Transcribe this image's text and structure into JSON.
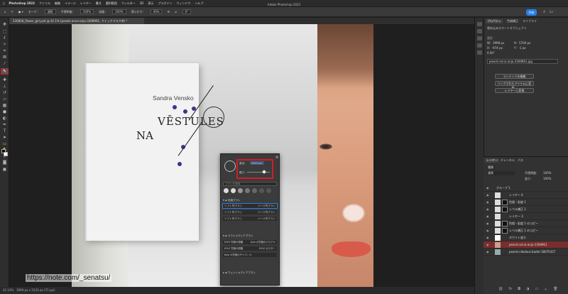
{
  "menubar": {
    "app": "Photoshop 2023",
    "items": [
      "ファイル",
      "編集",
      "イメージ",
      "レイヤー",
      "書式",
      "選択範囲",
      "フィルター",
      "3D",
      "表示",
      "プラグイン",
      "ウィンドウ",
      "ヘルプ"
    ]
  },
  "window_title": "Adobe Photoshop 2023",
  "options": {
    "mode_label": "モード：",
    "mode_value": "通常",
    "opacity_label": "不透明度：",
    "opacity_value": "100%",
    "flow_label": "流量：",
    "flow_value": "100%",
    "smooth_label": "滑らかさ：",
    "smooth_value": "40%",
    "angle_value": "0°",
    "share_label": "共有"
  },
  "document_tab": "230828_flower_girl.psd @ 42.1% (pexels-anna-anja-3308961, クイックマスク/8) *",
  "canvas": {
    "author": "Sandra Vensko",
    "title_line1": "VĒSTULES",
    "title_line2": "NA"
  },
  "brush_popup": {
    "size_label": "直径：",
    "size_value": "1012 px",
    "hardness_label": "硬さ：",
    "search_placeholder": "ブラシを検索",
    "group1": "汎用ブラシ",
    "brushes": [
      {
        "left": "ソフト円ブラシ",
        "right": "ハード円ブラシ"
      },
      {
        "left": "ソフト円ブラシ",
        "right": "ハード円ブラシ"
      },
      {
        "left": "ソフト円ブラシ",
        "right": "ハード円ブラシ"
      }
    ],
    "group2": "ドライメディアブラシ",
    "dry": [
      {
        "left": "KYLE 究極の鉛筆",
        "right": "Kyle の究極のパステル"
      },
      {
        "left": "KYLE 究極の鉛筆",
        "right": "KYLE ポスター"
      },
      {
        "left": "Kyle の究極のチャコール",
        "right": ""
      }
    ],
    "group3": "ウェットメディアブラシ"
  },
  "properties": {
    "tab1": "プロパティ",
    "tab2": "色調補正",
    "tab3": "ライブラリ",
    "section": "埋め込みスマートオブジェクト",
    "transform": "変形",
    "w": "W：3998 px",
    "h": "H：5700 px",
    "x": "X：-974 px",
    "y": "Y：-1 px",
    "angle": "0.00°",
    "file": "pexels-anna-anja-3308961.jpg",
    "btn1": "コンテンツを編集",
    "btn2": "リンクされたアイテムに変換...",
    "btn3": "レイヤーに変換"
  },
  "layers": {
    "tab1": "レイヤー",
    "tab2": "チャンネル",
    "tab3": "パス",
    "kind": "種類",
    "blend": "通常",
    "opacity_label": "不透明度：",
    "opacity_value": "100%",
    "fill_label": "塗り：",
    "fill_value": "100%",
    "items": [
      {
        "name": "グループ 1",
        "selected": false
      },
      {
        "name": "レイヤー 4",
        "selected": false
      },
      {
        "name": "色相・彩度 1",
        "selected": false
      },
      {
        "name": "レベル補正 1",
        "selected": false
      },
      {
        "name": "レイヤー 3",
        "selected": false
      },
      {
        "name": "色相・彩度 1 のコピー",
        "selected": false
      },
      {
        "name": "レベル補正 1 のコピー",
        "selected": false
      },
      {
        "name": "ホワイト塗り",
        "selected": false
      },
      {
        "name": "pexels-anna-anja-3308961",
        "selected": true
      },
      {
        "name": "pexels-nikolaus-bader-18070327",
        "selected": false
      }
    ]
  },
  "status": {
    "zoom": "42.14%",
    "size": "3999 px x 5333 px (72 ppi)"
  },
  "watermark": "https://note.com/_senatsu/"
}
